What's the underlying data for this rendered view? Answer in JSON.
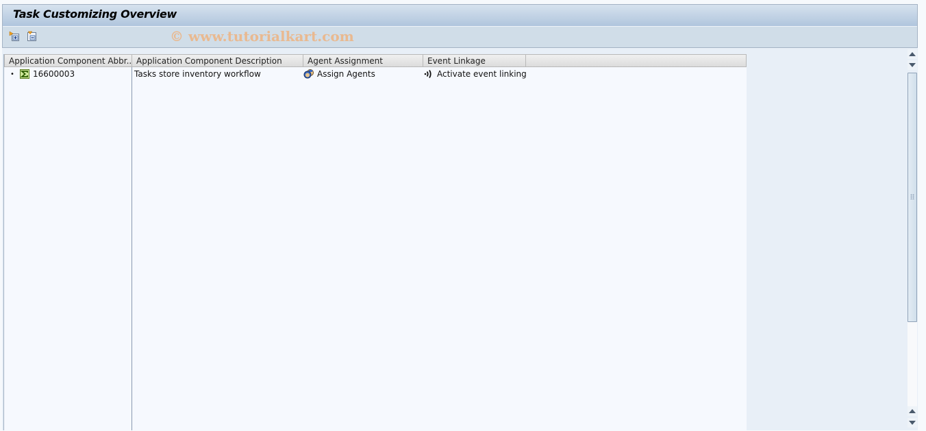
{
  "window": {
    "title": "Task Customizing Overview"
  },
  "toolbar": {
    "buttons": [
      {
        "name": "expand-subtree-button",
        "icon": "expand-node-icon"
      },
      {
        "name": "collapse-subtree-button",
        "icon": "collapse-node-icon"
      }
    ],
    "watermark": "© www.tutorialkart.com"
  },
  "tree": {
    "columns": [
      "Application Component Abbr...",
      "Application Component Description",
      "Agent Assignment",
      "Event Linkage"
    ],
    "rows": [
      {
        "bullet": "•",
        "icon": "sigma-icon",
        "abbr": "16600003",
        "description": "Tasks store inventory workflow",
        "agent_icon": "agents-icon",
        "agent": "Assign Agents",
        "event_icon": "event-link-icon",
        "event": "Activate event linking"
      }
    ]
  },
  "scrollbar": {
    "position": 0
  },
  "colors": {
    "title_gradient_top": "#d6e2ee",
    "title_gradient_bottom": "#b0c5dd",
    "toolbar_bg": "#d0dde8",
    "watermark": "#e9b990"
  }
}
